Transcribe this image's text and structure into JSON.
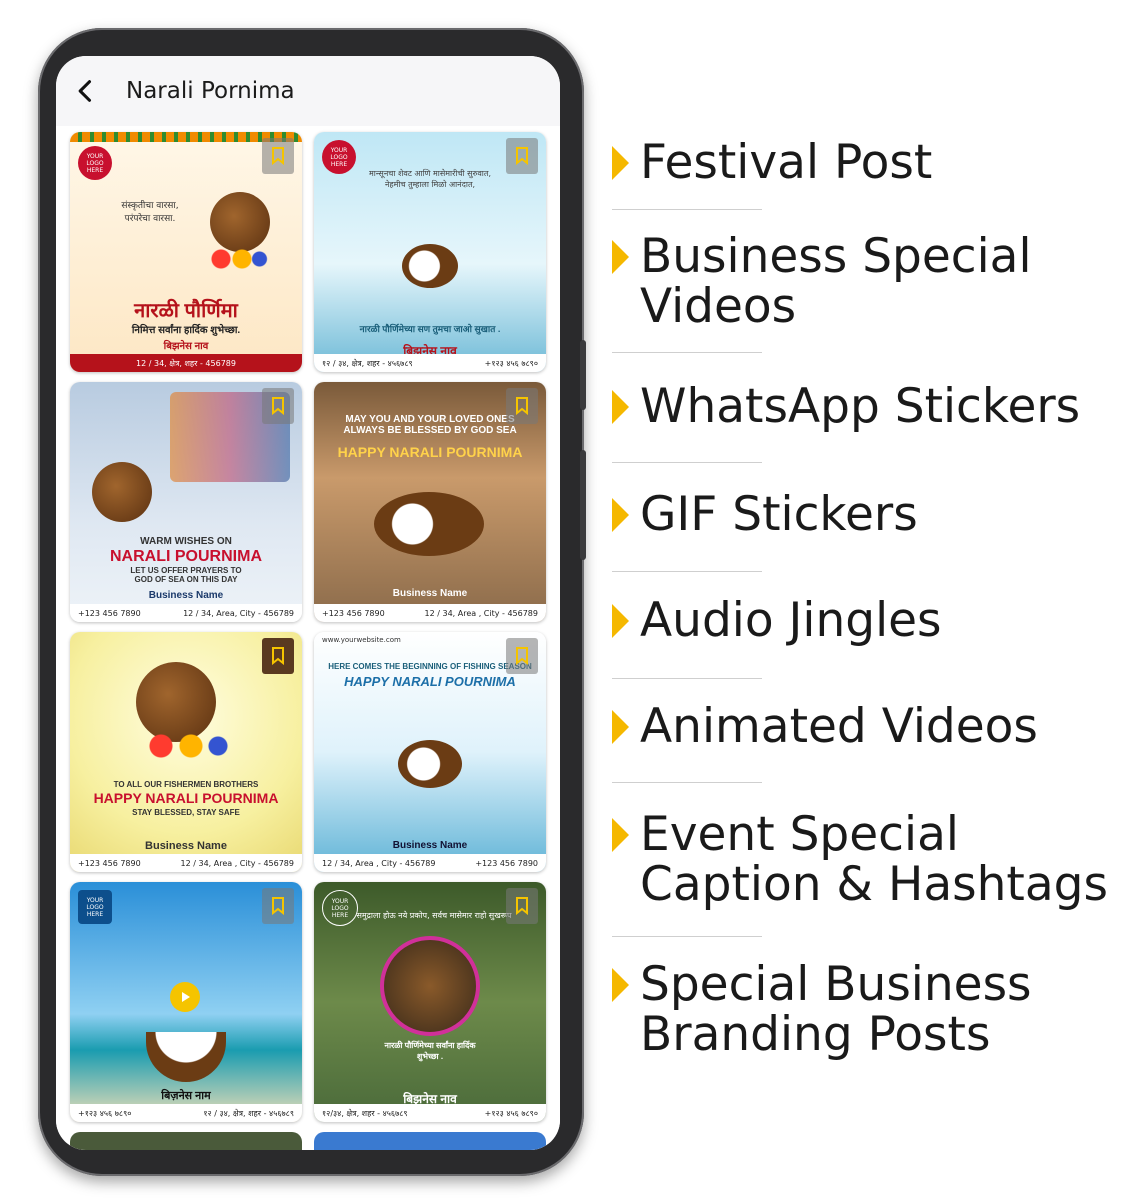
{
  "app": {
    "title": "Narali Pornima"
  },
  "cards": [
    {
      "type": "image",
      "marathi_top": "संस्कृतीचा वारसा, परंपरेचा वारसा.",
      "title": "नारळी पौर्णिमा",
      "subtitle": "निमित्त सर्वांना हार्दिक शुभेच्छा.",
      "business": "बिझनेस नाव",
      "footer": "12 / 34, क्षेत्र, शहर - 456789",
      "logo": "YOUR LOGO HERE"
    },
    {
      "type": "image",
      "marathi_top": "मान्सूनचा शेवट आणि मासेमारीची सुरुवात, नेहमीच तुम्हाला मिळो आनंदात,",
      "title": "नारळी पौर्णिमेच्या सण तुमचा जाओ सुखात .",
      "business": "बिझनेस नाव",
      "footer_left": "१२ / ३४, क्षेत्र, शहर - ४५६७८९",
      "footer_right": "+१२३ ४५६ ७८९०",
      "logo": "YOUR LOGO HERE"
    },
    {
      "type": "image",
      "line1": "WARM WISHES ON",
      "title": "NARALI POURNIMA",
      "line2": "LET US OFFER PRAYERS TO GOD OF SEA ON THIS DAY",
      "business": "Business Name",
      "footer_left": "+123 456 7890",
      "footer_right": "12 / 34, Area, City - 456789"
    },
    {
      "type": "image",
      "line1": "MAY YOU AND YOUR LOVED ONES ALWAYS BE BLESSED BY GOD SEA",
      "title": "HAPPY NARALI POURNIMA",
      "business": "Business Name",
      "footer_left": "+123 456 7890",
      "footer_right": "12 / 34, Area , City - 456789"
    },
    {
      "type": "image",
      "line1": "TO ALL OUR FISHERMEN BROTHERS",
      "title": "HAPPY NARALI POURNIMA",
      "line2": "STAY BLESSED, STAY SAFE",
      "business": "Business Name",
      "footer_left": "+123 456 7890",
      "footer_right": "12 / 34, Area , City - 456789"
    },
    {
      "type": "image",
      "website": "www.yourwebsite.com",
      "line1": "HERE COMES THE BEGINNING OF FISHING SEASON",
      "title": "HAPPY NARALI POURNIMA",
      "business": "Business Name",
      "footer_left": "12 / 34, Area , City - 456789",
      "footer_right": "+123 456 7890"
    },
    {
      "type": "video",
      "business": "बिज़नेस नाम",
      "footer_left": "+१२३ ४५६ ७८९०",
      "footer_right": "१२ / ३४, क्षेत्र, शहर - ४५६७८९",
      "logo": "YOUR LOGO HERE"
    },
    {
      "type": "image",
      "marathi_top": "समुद्राला होऊ नये प्रकोप, सर्वच मासेमार राहो सुखरूप",
      "title": "नारळी पौर्णिमेच्या सर्वांना हार्दिक शुभेच्छा .",
      "business": "बिझनेस नाव",
      "footer_left": "१२/३४, क्षेत्र, शहर - ४५६७८९",
      "footer_right": "+१२३ ४५६ ७८९०",
      "logo": "YOUR LOGO HERE"
    }
  ],
  "features": [
    {
      "label": "Festival Post"
    },
    {
      "label": "Business Special\nVideos"
    },
    {
      "label": "WhatsApp Stickers"
    },
    {
      "label": "GIF Stickers"
    },
    {
      "label": "Audio Jingles"
    },
    {
      "label": "Animated Videos"
    },
    {
      "label": "Event Special\nCaption & Hashtags"
    },
    {
      "label": "Special Business\nBranding Posts"
    }
  ],
  "colors": {
    "accent": "#f5b800",
    "text": "#1a1a1a",
    "phone_frame": "#2a2a2c"
  }
}
